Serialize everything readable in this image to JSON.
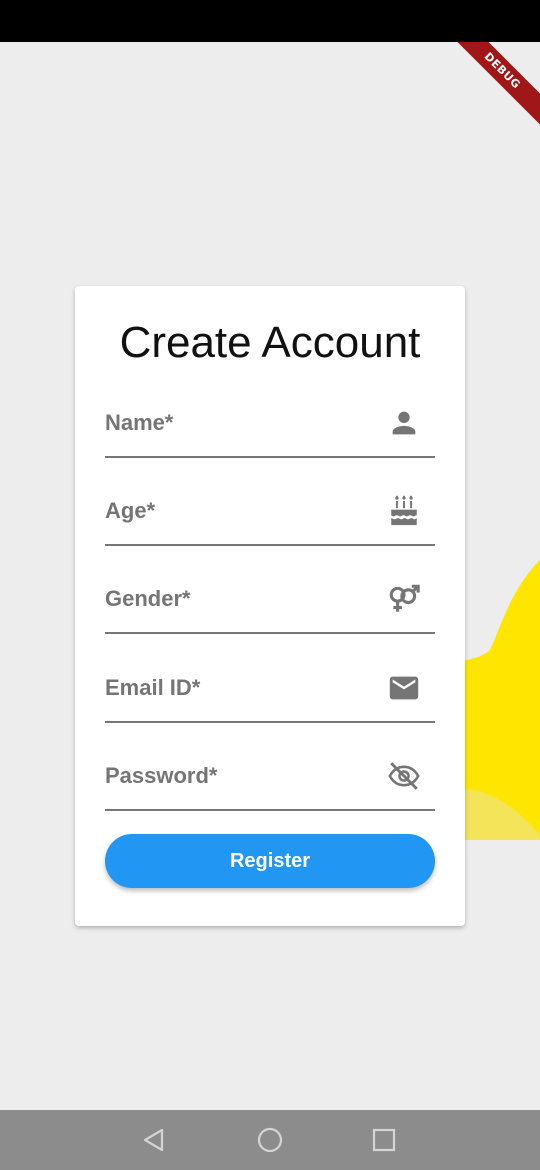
{
  "app": {
    "debug_banner": "DEBUG"
  },
  "form": {
    "title": "Create Account",
    "fields": [
      {
        "label": "Name*",
        "icon": "person-icon"
      },
      {
        "label": "Age*",
        "icon": "cake-icon"
      },
      {
        "label": "Gender*",
        "icon": "gender-icon"
      },
      {
        "label": "Email ID*",
        "icon": "email-icon"
      },
      {
        "label": "Password*",
        "icon": "visibility-off-icon"
      }
    ],
    "register_label": "Register"
  },
  "nav": {
    "buttons": [
      "back-icon",
      "home-icon",
      "recents-icon"
    ]
  },
  "colors": {
    "accent": "#2196f3",
    "blob": "#ffe600",
    "banner": "#a01717"
  }
}
